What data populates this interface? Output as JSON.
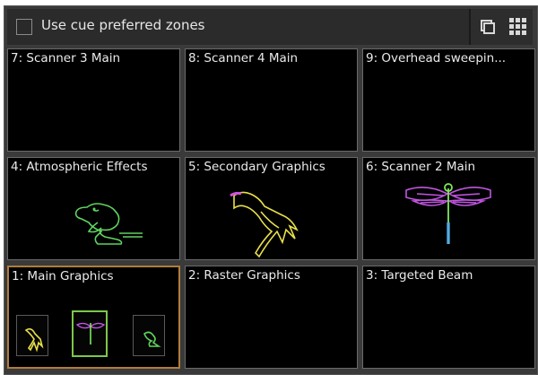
{
  "topbar": {
    "cue_checkbox_label": "Use cue preferred zones",
    "cue_checkbox_checked": false,
    "single_view_icon": "single-window-icon",
    "grid_view_icon": "grid-3x3-icon"
  },
  "zones": [
    {
      "title": "7: Scanner 3 Main"
    },
    {
      "title": "8: Scanner 4 Main"
    },
    {
      "title": "9: Overhead sweepin..."
    },
    {
      "title": "4: Atmospheric Effects",
      "graphic": "frog"
    },
    {
      "title": "5: Secondary Graphics",
      "graphic": "bird"
    },
    {
      "title": "6: Scanner 2 Main",
      "graphic": "dragonfly"
    },
    {
      "title": "1: Main Graphics",
      "selected": true
    },
    {
      "title": "2: Raster Graphics"
    },
    {
      "title": "3: Targeted Beam"
    }
  ],
  "thumbnails": [
    {
      "graphic": "bird",
      "active": false
    },
    {
      "graphic": "dragonfly",
      "active": true
    },
    {
      "graphic": "frog",
      "active": false
    }
  ],
  "colors": {
    "selected_border": "#b07d3a",
    "active_thumb_border": "#7cc84a",
    "frog": "#5fd35f",
    "bird": "#e8e04a",
    "dragonfly_wing": "#c055e0",
    "dragonfly_body": "#7fe85a"
  }
}
